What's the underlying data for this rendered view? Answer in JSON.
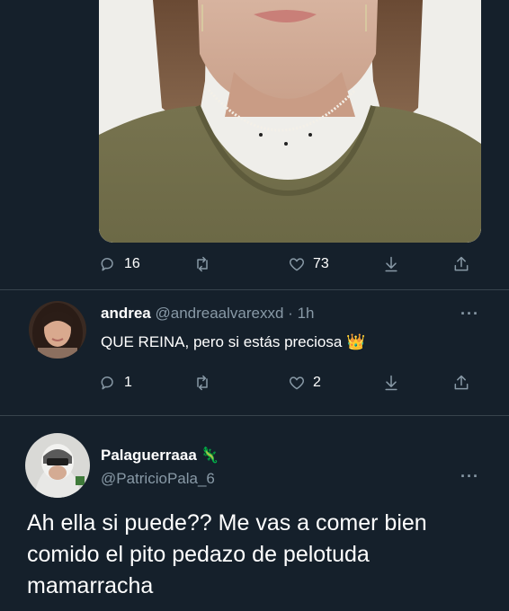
{
  "original_tweet": {
    "stats": {
      "replies": "16",
      "likes": "73"
    },
    "icons": [
      "reply-icon",
      "retweet-icon",
      "like-icon",
      "save-icon",
      "share-icon"
    ]
  },
  "reply": {
    "name": "andrea",
    "handle": "@andreaalvarexxd",
    "separator": "·",
    "time": "1h",
    "text": "QUE REINA, pero si estás preciosa",
    "emoji": "👑",
    "stats": {
      "replies": "1",
      "likes": "2"
    },
    "more": "···"
  },
  "focus_tweet": {
    "name": "Palaguerraaa",
    "name_emoji": "🦎",
    "handle": "@PatricioPala_6",
    "text": "Ah ella si puede?? Me vas a comer bien comido el pito pedazo de pelotuda mamarracha",
    "more": "···"
  },
  "colors": {
    "background": "#15202b",
    "secondary_text": "#8899a6",
    "divider": "#38444d"
  }
}
